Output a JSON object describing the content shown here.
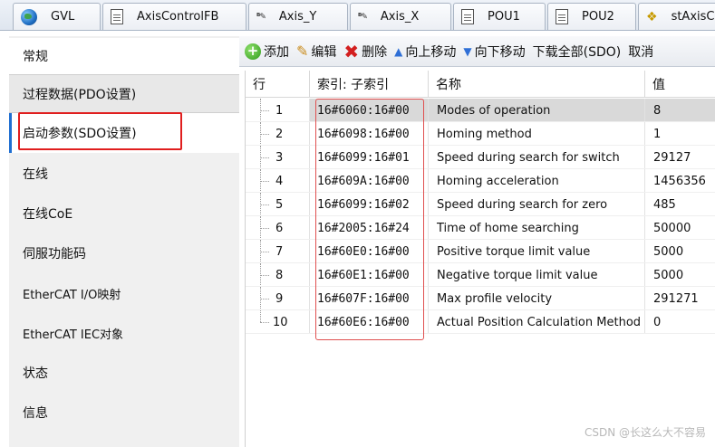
{
  "tabs": [
    {
      "label": "GVL",
      "icon": "globe-icon"
    },
    {
      "label": "AxisControlFB",
      "icon": "document-icon"
    },
    {
      "label": "Axis_Y",
      "icon": "axis-edit-icon"
    },
    {
      "label": "Axis_X",
      "icon": "axis-edit-icon"
    },
    {
      "label": "POU1",
      "icon": "document-icon"
    },
    {
      "label": "POU2",
      "icon": "document-icon"
    },
    {
      "label": "stAxisC",
      "icon": "struct-icon"
    }
  ],
  "sidebar": {
    "items": [
      {
        "label": "常规"
      },
      {
        "label": "过程数据(PDO设置)"
      },
      {
        "label": "启动参数(SDO设置)"
      },
      {
        "label": "在线"
      },
      {
        "label": "在线CoE"
      },
      {
        "label": "伺服功能码"
      },
      {
        "label": "EtherCAT I/O映射"
      },
      {
        "label": "EtherCAT IEC对象"
      },
      {
        "label": "状态"
      },
      {
        "label": "信息"
      }
    ],
    "active_index": 2
  },
  "toolbar": {
    "add": "添加",
    "edit": "编辑",
    "delete": "删除",
    "move_up": "向上移动",
    "move_down": "向下移动",
    "download_all": "下载全部(SDO)",
    "cancel": "取消"
  },
  "table": {
    "columns": [
      "行",
      "索引: 子索引",
      "名称",
      "值"
    ],
    "rows": [
      {
        "line": "1",
        "index": "16#6060:16#00",
        "name": "Modes of operation",
        "value": "8"
      },
      {
        "line": "2",
        "index": "16#6098:16#00",
        "name": "Homing method",
        "value": "1"
      },
      {
        "line": "3",
        "index": "16#6099:16#01",
        "name": "Speed during search for switch",
        "value": "29127"
      },
      {
        "line": "4",
        "index": "16#609A:16#00",
        "name": "Homing acceleration",
        "value": "1456356"
      },
      {
        "line": "5",
        "index": "16#6099:16#02",
        "name": "Speed during search for zero",
        "value": "485"
      },
      {
        "line": "6",
        "index": "16#2005:16#24",
        "name": "Time of home searching",
        "value": "50000"
      },
      {
        "line": "7",
        "index": "16#60E0:16#00",
        "name": "Positive torque limit value",
        "value": "5000"
      },
      {
        "line": "8",
        "index": "16#60E1:16#00",
        "name": "Negative torque limit value",
        "value": "5000"
      },
      {
        "line": "9",
        "index": "16#607F:16#00",
        "name": "Max profile velocity",
        "value": "291271"
      },
      {
        "line": "10",
        "index": "16#60E6:16#00",
        "name": "Actual Position Calculation Method",
        "value": "0"
      }
    ],
    "selected_row": 0
  },
  "watermark": "CSDN @长这么大不容易",
  "colors": {
    "accent": "#1f6fd1",
    "highlight_red": "#e01e1e",
    "selection": "#d9d9d9"
  }
}
